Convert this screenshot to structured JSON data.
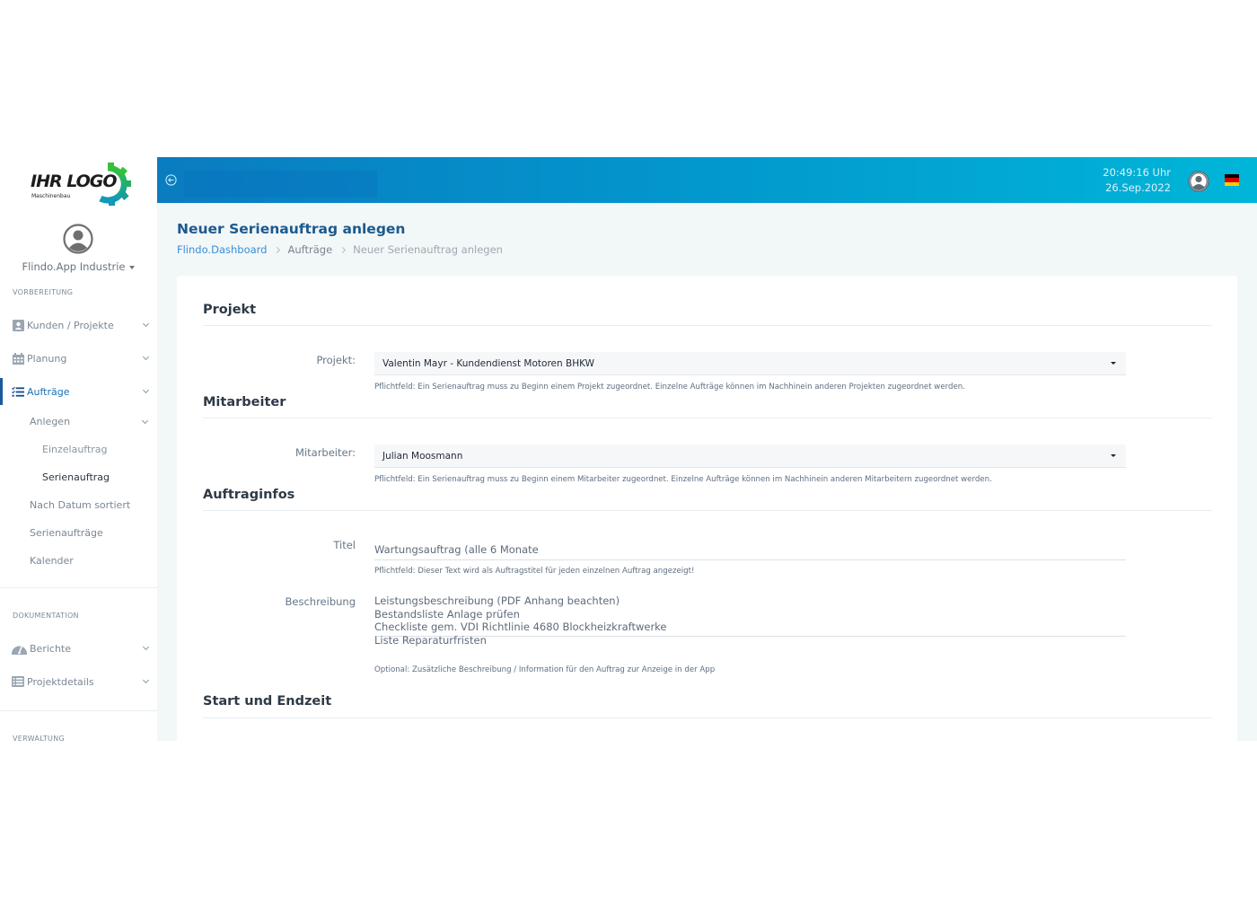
{
  "brand": {
    "logo_text": "IHR LOGO",
    "logo_sub": "Maschinenbau",
    "colors": {
      "accent": "#1a6fb0",
      "topbar_start": "#0a7cc0",
      "topbar_end": "#00b6d8",
      "gear_green": "#2fbf3a",
      "gear_teal": "#16a2b8"
    }
  },
  "sidebar": {
    "user_name": "Flindo.App Industrie",
    "sections": [
      {
        "label": "VORBEREITUNG"
      },
      {
        "label": "DOKUMENTATION"
      },
      {
        "label": "VERWALTUNG"
      }
    ],
    "items": [
      {
        "label": "Kunden / Projekte",
        "icon": "contact-card-icon"
      },
      {
        "label": "Planung",
        "icon": "calendar-icon"
      },
      {
        "label": "Aufträge",
        "icon": "task-list-icon",
        "active": true
      },
      {
        "label": "Berichte",
        "icon": "dashboard-gauge-icon"
      },
      {
        "label": "Projektdetails",
        "icon": "list-table-icon"
      }
    ],
    "auftraege_sub": {
      "anlegen": "Anlegen",
      "einzelauftrag": "Einzelauftrag",
      "serienauftrag": "Serienauftrag",
      "nach_datum": "Nach Datum sortiert",
      "serienauftraege": "Serienaufträge",
      "kalender": "Kalender"
    }
  },
  "topbar": {
    "time": "20:49:16 Uhr",
    "date": "26.Sep.2022",
    "language": "de"
  },
  "page": {
    "title": "Neuer Serienauftrag anlegen",
    "breadcrumb": [
      "Flindo.Dashboard",
      "Aufträge",
      "Neuer Serienauftrag anlegen"
    ]
  },
  "form": {
    "projekt": {
      "section": "Projekt",
      "label": "Projekt:",
      "value": "Valentin Mayr - Kundendienst Motoren BHKW",
      "help": "Pflichtfeld: Ein Serienauftrag muss zu Beginn einem Projekt zugeordnet. Einzelne Aufträge können im Nachhinein anderen Projekten zugeordnet werden."
    },
    "mitarbeiter": {
      "section": "Mitarbeiter",
      "label": "Mitarbeiter:",
      "value": "Julian Moosmann",
      "help": "Pflichtfeld: Ein Serienauftrag muss zu Beginn einem Mitarbeiter zugeordnet. Einzelne Aufträge können im Nachhinein anderen Mitarbeitern zugeordnet werden."
    },
    "auftraginfos": {
      "section": "Auftraginfos",
      "titel_label": "Titel",
      "titel_value": "Wartungsauftrag (alle 6 Monate",
      "titel_help": "Pflichtfeld: Dieser Text wird als Auftragstitel für jeden einzelnen Auftrag angezeigt!",
      "beschreibung_label": "Beschreibung",
      "beschreibung_lines": [
        "Leistungsbeschreibung (PDF Anhang beachten)",
        "Bestandsliste Anlage prüfen",
        "Checkliste gem. VDI Richtlinie 4680 Blockheizkraftwerke",
        "Liste Reparaturfristen"
      ],
      "beschreibung_help": "Optional: Zusätzliche Beschreibung / Information für den Auftrag zur Anzeige in der App"
    },
    "zeit": {
      "section": "Start und Endzeit"
    }
  }
}
